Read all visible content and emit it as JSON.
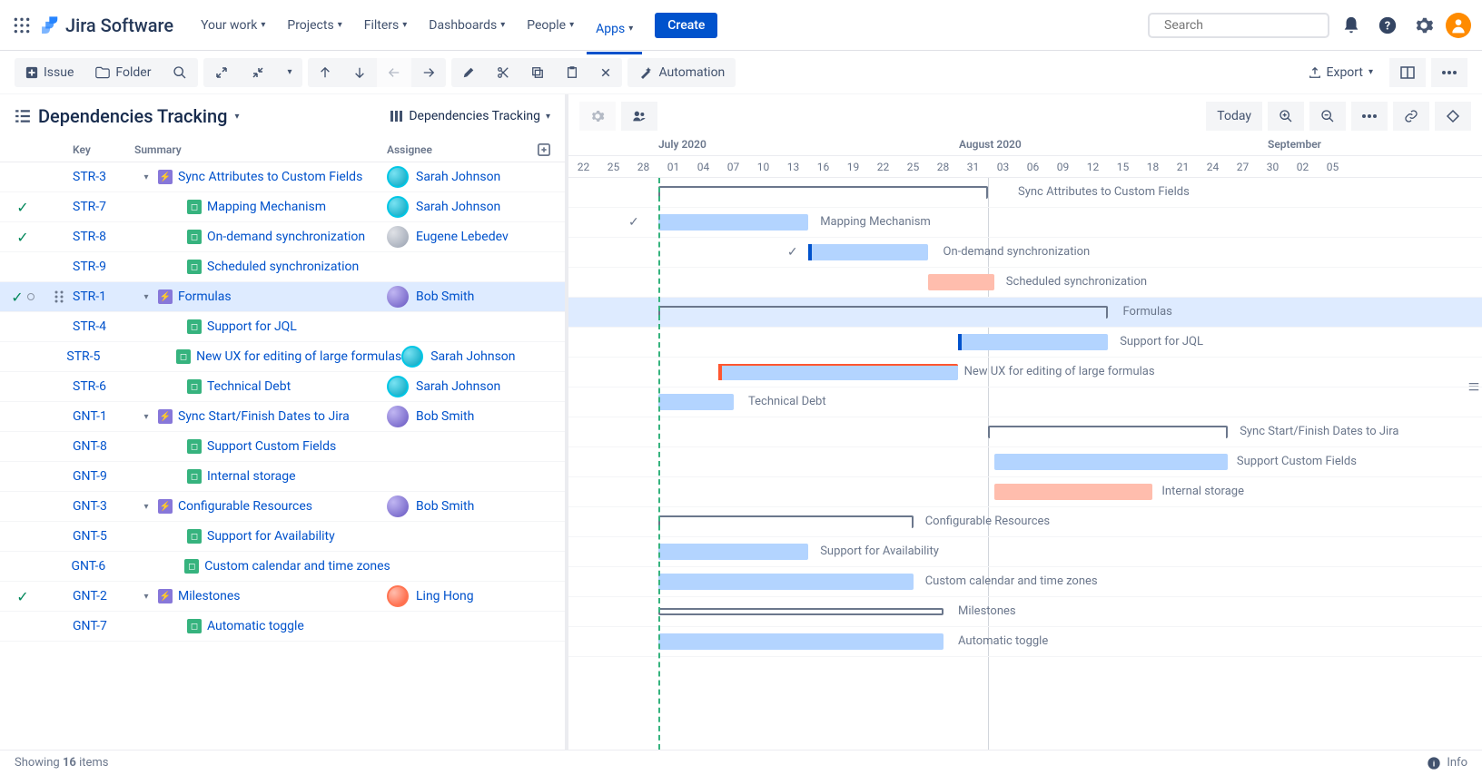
{
  "header": {
    "logo_text": "Jira Software",
    "nav": [
      "Your work",
      "Projects",
      "Filters",
      "Dashboards",
      "People",
      "Apps"
    ],
    "active_nav": "Apps",
    "create": "Create",
    "search_placeholder": "Search"
  },
  "toolbar": {
    "issue": "Issue",
    "folder": "Folder",
    "automation": "Automation",
    "export": "Export"
  },
  "panel": {
    "title": "Dependencies Tracking",
    "view": "Dependencies Tracking",
    "cols": {
      "key": "Key",
      "summary": "Summary",
      "assignee": "Assignee"
    }
  },
  "gantt": {
    "today": "Today",
    "months": [
      "July 2020",
      "August 2020",
      "September"
    ],
    "days": [
      "22",
      "25",
      "28",
      "01",
      "04",
      "07",
      "10",
      "13",
      "16",
      "19",
      "22",
      "25",
      "28",
      "31",
      "03",
      "06",
      "09",
      "12",
      "15",
      "18",
      "21",
      "24",
      "27",
      "30",
      "02",
      "05"
    ]
  },
  "rows": [
    {
      "key": "STR-3",
      "summary": "Sync Attributes to Custom Fields",
      "type": "epic",
      "level": 0,
      "expanded": true,
      "assignee": "Sarah Johnson",
      "avatar": "teal",
      "done": false,
      "bar": {
        "kind": "outline",
        "start": 3,
        "end": 14,
        "label": "Sync Attributes to Custom Fields",
        "labelPos": 15
      }
    },
    {
      "key": "STR-7",
      "summary": "Mapping Mechanism",
      "type": "story",
      "level": 1,
      "assignee": "Sarah Johnson",
      "avatar": "teal",
      "done": true,
      "bar": {
        "kind": "blue",
        "start": 3,
        "end": 8,
        "label": "Mapping Mechanism",
        "labelPos": 8.4,
        "check": 2
      }
    },
    {
      "key": "STR-8",
      "summary": "On-demand synchronization",
      "type": "story",
      "level": 1,
      "assignee": "Eugene Lebedev",
      "avatar": "gray",
      "done": true,
      "bar": {
        "kind": "blue",
        "start": 8,
        "end": 12,
        "lead": "#0052cc",
        "label": "On-demand synchronization",
        "labelPos": 12.5,
        "check": 7.3
      }
    },
    {
      "key": "STR-9",
      "summary": "Scheduled synchronization",
      "type": "story",
      "level": 1,
      "assignee": "",
      "avatar": "",
      "done": false,
      "bar": {
        "kind": "pink",
        "start": 12,
        "end": 14.2,
        "label": "Scheduled synchronization",
        "labelPos": 14.6
      }
    },
    {
      "key": "STR-1",
      "summary": "Formulas",
      "type": "epic",
      "level": 0,
      "expanded": true,
      "assignee": "Bob Smith",
      "avatar": "purple",
      "done": false,
      "selected": true,
      "doneAndDot": true,
      "bar": {
        "kind": "outline",
        "start": 3,
        "end": 18,
        "label": "Formulas",
        "labelPos": 18.5
      }
    },
    {
      "key": "STR-4",
      "summary": "Support for JQL",
      "type": "story",
      "level": 1,
      "assignee": "",
      "avatar": "",
      "done": false,
      "bar": {
        "kind": "blue",
        "start": 13,
        "end": 18,
        "lead": "#0052cc",
        "label": "Support for JQL",
        "labelPos": 18.4
      }
    },
    {
      "key": "STR-5",
      "summary": "New UX for editing of large formulas",
      "type": "story",
      "level": 1,
      "assignee": "Sarah Johnson",
      "avatar": "teal",
      "done": false,
      "bar": {
        "kind": "blue",
        "start": 5,
        "end": 13,
        "lead": "#ff5630",
        "label": "New UX for editing of large formulas",
        "labelPos": 13.2,
        "redTop": true
      }
    },
    {
      "key": "STR-6",
      "summary": "Technical Debt",
      "type": "story",
      "level": 1,
      "assignee": "Sarah Johnson",
      "avatar": "teal",
      "done": false,
      "bar": {
        "kind": "blue",
        "start": 3,
        "end": 5.5,
        "label": "Technical Debt",
        "labelPos": 6
      }
    },
    {
      "key": "GNT-1",
      "summary": "Sync Start/Finish Dates to Jira",
      "type": "epic",
      "level": 0,
      "expanded": true,
      "assignee": "Bob Smith",
      "avatar": "purple",
      "done": false,
      "bar": {
        "kind": "outline",
        "start": 14,
        "end": 22,
        "label": "Sync Start/Finish Dates to Jira",
        "labelPos": 22.4
      }
    },
    {
      "key": "GNT-8",
      "summary": "Support Custom Fields",
      "type": "story",
      "level": 1,
      "assignee": "",
      "avatar": "",
      "done": false,
      "bar": {
        "kind": "blue",
        "start": 14.2,
        "end": 22,
        "label": "Support Custom Fields",
        "labelPos": 22.3
      }
    },
    {
      "key": "GNT-9",
      "summary": "Internal storage",
      "type": "story",
      "level": 1,
      "assignee": "",
      "avatar": "",
      "done": false,
      "bar": {
        "kind": "pink",
        "start": 14.2,
        "end": 19.5,
        "label": "Internal storage",
        "labelPos": 19.8
      }
    },
    {
      "key": "GNT-3",
      "summary": "Configurable Resources",
      "type": "epic",
      "level": 0,
      "expanded": true,
      "assignee": "Bob Smith",
      "avatar": "purple",
      "done": false,
      "bar": {
        "kind": "outline",
        "start": 3,
        "end": 11.5,
        "label": "Configurable Resources",
        "labelPos": 11.9
      }
    },
    {
      "key": "GNT-5",
      "summary": "Support for Availability",
      "type": "story",
      "level": 1,
      "assignee": "",
      "avatar": "",
      "done": false,
      "bar": {
        "kind": "blue",
        "start": 3,
        "end": 8,
        "label": "Support for Availability",
        "labelPos": 8.4
      }
    },
    {
      "key": "GNT-6",
      "summary": "Custom calendar and time zones",
      "type": "story",
      "level": 1,
      "assignee": "",
      "avatar": "",
      "done": false,
      "bar": {
        "kind": "blue",
        "start": 3,
        "end": 11.5,
        "label": "Custom calendar and time zones",
        "labelPos": 11.9
      }
    },
    {
      "key": "GNT-2",
      "summary": "Milestones",
      "type": "epic",
      "level": 0,
      "expanded": true,
      "assignee": "Ling Hong",
      "avatar": "orange",
      "done": true,
      "bar": {
        "kind": "outline-closed",
        "start": 3,
        "end": 12.5,
        "label": "Milestones",
        "labelPos": 13
      }
    },
    {
      "key": "GNT-7",
      "summary": "Automatic toggle",
      "type": "story",
      "level": 1,
      "assignee": "",
      "avatar": "",
      "done": false,
      "bar": {
        "kind": "blue",
        "start": 3,
        "end": 12.5,
        "label": "Automatic toggle",
        "labelPos": 13
      }
    }
  ],
  "footer": {
    "showing_prefix": "Showing",
    "count": "16",
    "showing_suffix": "items",
    "info": "Info"
  }
}
